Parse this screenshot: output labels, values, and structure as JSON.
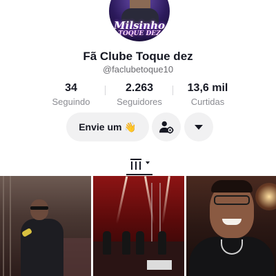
{
  "profile": {
    "avatar_logo_main": "Milsinho",
    "avatar_logo_sub": "TOQUE DEZ",
    "display_name": "Fã Clube Toque dez",
    "handle": "@faclubetoque10"
  },
  "stats": [
    {
      "value": "34",
      "label": "Seguindo"
    },
    {
      "value": "2.263",
      "label": "Seguidores"
    },
    {
      "value": "13,6 mil",
      "label": "Curtidas"
    }
  ],
  "actions": {
    "message_label": "Envie um 👋",
    "friend_icon": "add-friend-icon",
    "more_icon": "chevron-down-icon"
  },
  "tabs": {
    "active": "videos",
    "videos_icon": "video-grid-icon"
  },
  "videos": [
    {
      "description": "Singer in black jacket with microphone on stage"
    },
    {
      "description": "Band performing on stage under red lights"
    },
    {
      "description": "Smiling singer with glasses and chain close-up"
    }
  ],
  "colors": {
    "text": "#161823",
    "muted": "#8a8b91",
    "button_bg": "#f1f1f2"
  }
}
